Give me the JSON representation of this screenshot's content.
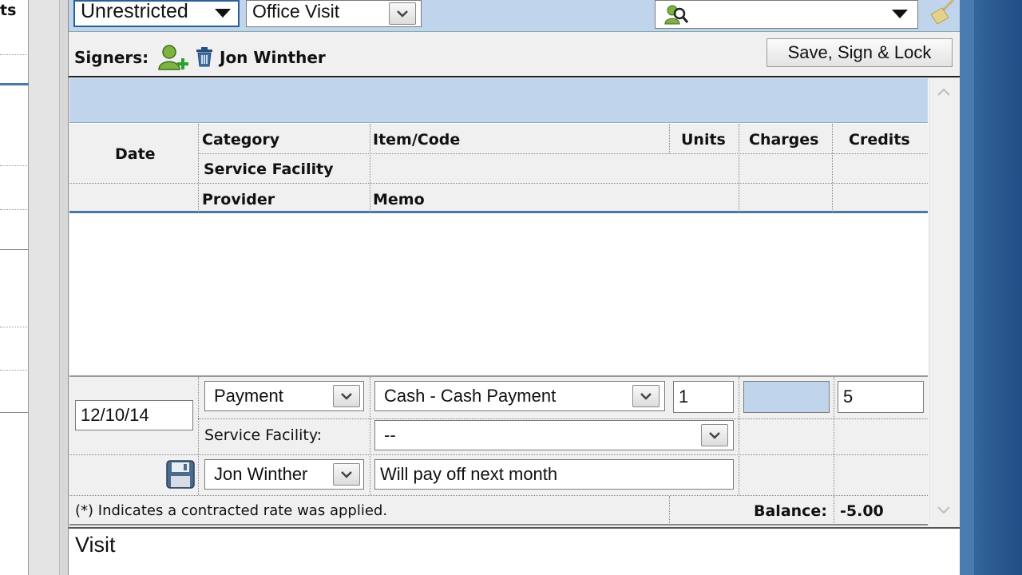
{
  "left_panel": {
    "partial_label": "ts"
  },
  "top_bar": {
    "restriction_select": "Unrestricted",
    "visit_type_select": "Office Visit",
    "search_select": ""
  },
  "signers": {
    "label": "Signers:",
    "signer_name": "Jon Winther",
    "save_button": "Save, Sign & Lock"
  },
  "grid": {
    "headers": {
      "date": "Date",
      "category": "Category",
      "item_code": "Item/Code",
      "units": "Units",
      "charges": "Charges",
      "credits": "Credits",
      "service_facility": "Service Facility",
      "provider": "Provider",
      "memo": "Memo"
    },
    "entry": {
      "date": "12/10/14",
      "category": "Payment",
      "item_code": "Cash - Cash Payment",
      "units": "1",
      "charges": "",
      "credits": "5",
      "service_facility_label": "Service Facility:",
      "service_facility_value": "--",
      "provider": "Jon Winther",
      "memo": "Will pay off next month"
    },
    "footer": {
      "note": "(*) Indicates a contracted rate was applied.",
      "balance_label": "Balance:",
      "balance_value": "-5.00"
    }
  },
  "visit_section": {
    "text": "Visit"
  },
  "colors": {
    "header_blue": "#c0d5ec",
    "desktop_blue": "#2f5f94"
  },
  "icons": [
    "dropdown-arrow-icon",
    "search-person-icon",
    "broom-icon",
    "add-signer-icon",
    "trash-icon",
    "save-disk-icon",
    "scroll-up-icon",
    "scroll-down-icon"
  ]
}
